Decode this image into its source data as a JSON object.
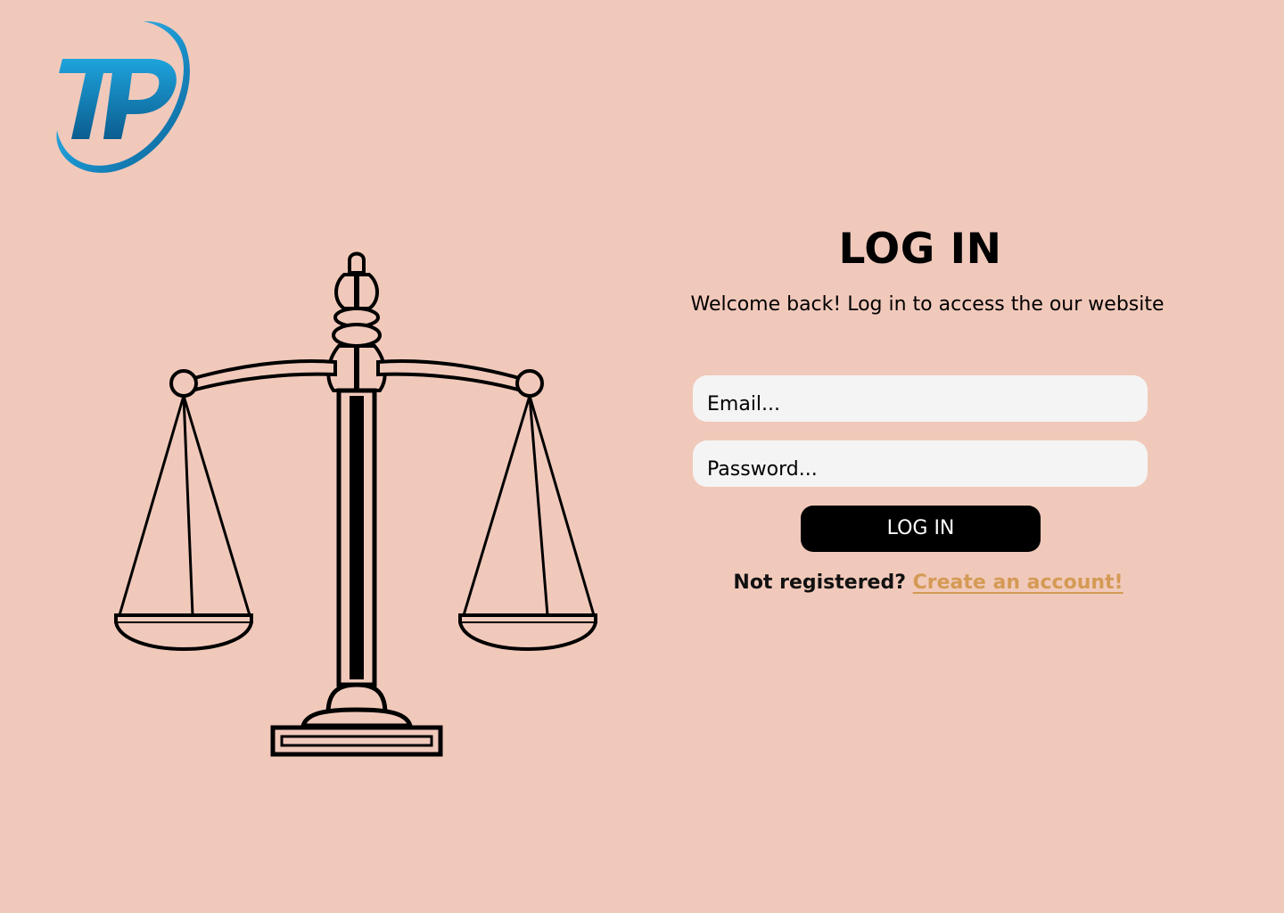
{
  "brand": {
    "logo_text": "TP",
    "colors": {
      "primary": "#1b95cf",
      "dark": "#0b5d8f",
      "light": "#5bc6ee"
    }
  },
  "illustration": {
    "icon": "scales-of-justice-icon"
  },
  "login": {
    "title": "LOG IN",
    "subtitle": "Welcome back! Log in to access the our website",
    "email_placeholder": "Email...",
    "password_placeholder": "Password...",
    "button_label": "LOG IN",
    "register_prompt": "Not registered?",
    "register_link": "Create an account!"
  },
  "colors": {
    "background": "#f1c9bb",
    "input_bg": "#f4f4f4",
    "button_bg": "#000000",
    "link": "#d49a55"
  }
}
